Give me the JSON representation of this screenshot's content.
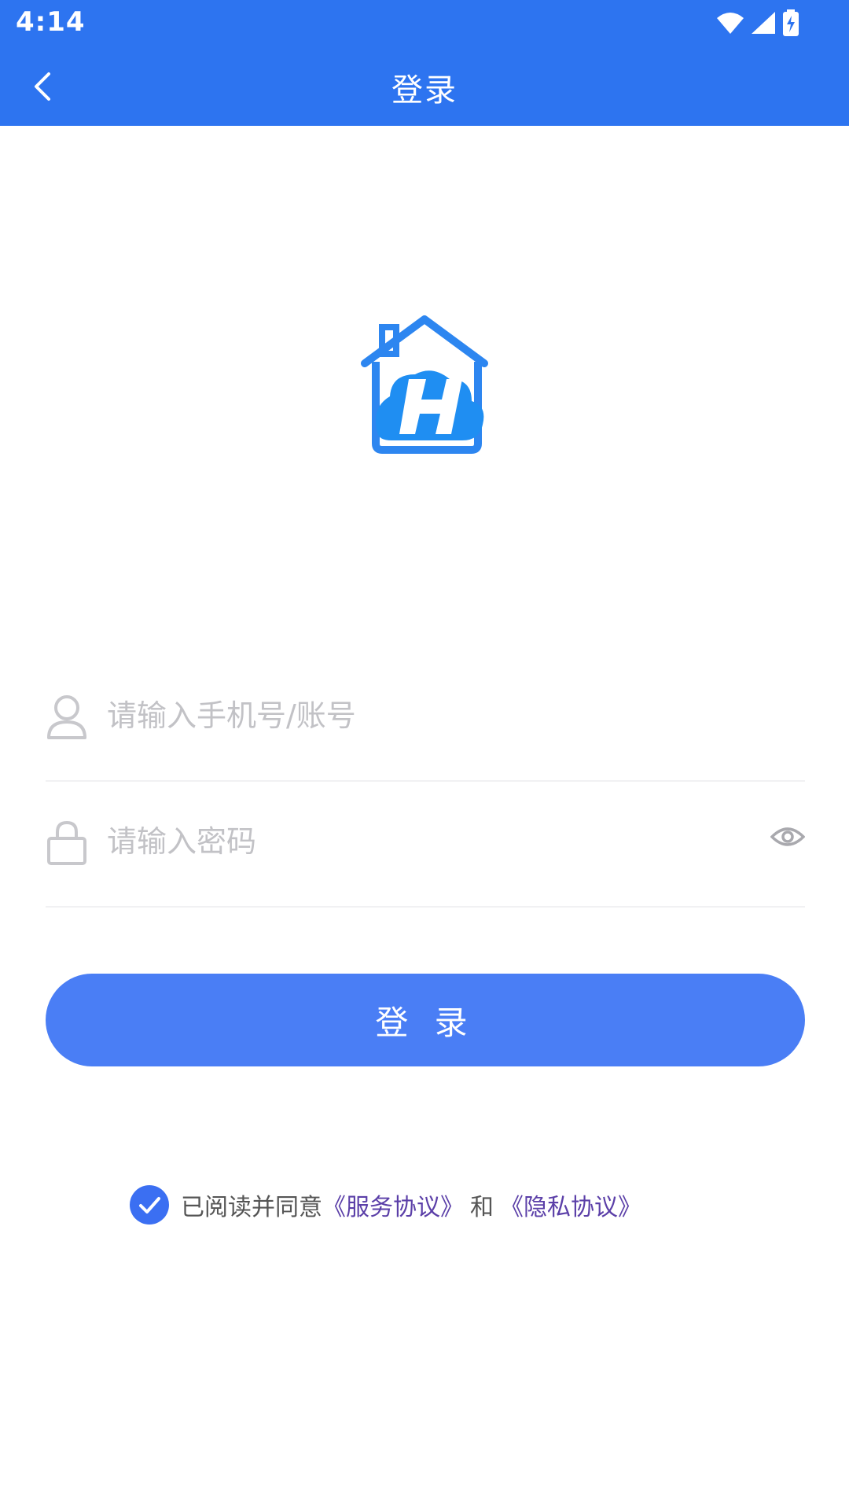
{
  "status_bar": {
    "time": "4:14"
  },
  "app_bar": {
    "title": "登录"
  },
  "login_form": {
    "username_placeholder": "请输入手机号/账号",
    "password_placeholder": "请输入密码",
    "submit_label": "登 录"
  },
  "agreement": {
    "checked": true,
    "prefix": "已阅读并同意",
    "service_link": "《服务协议》",
    "conjunction": "和",
    "privacy_link": "《隐私协议》"
  },
  "colors": {
    "brand_blue": "#2d74f0",
    "button_blue": "#4a7ef5",
    "link_purple": "#5b3fa8"
  },
  "icons": [
    "back-arrow-icon",
    "wifi-icon",
    "cell-signal-icon",
    "battery-charging-icon",
    "app-logo-icon",
    "user-icon",
    "lock-icon",
    "eye-icon",
    "check-icon"
  ]
}
